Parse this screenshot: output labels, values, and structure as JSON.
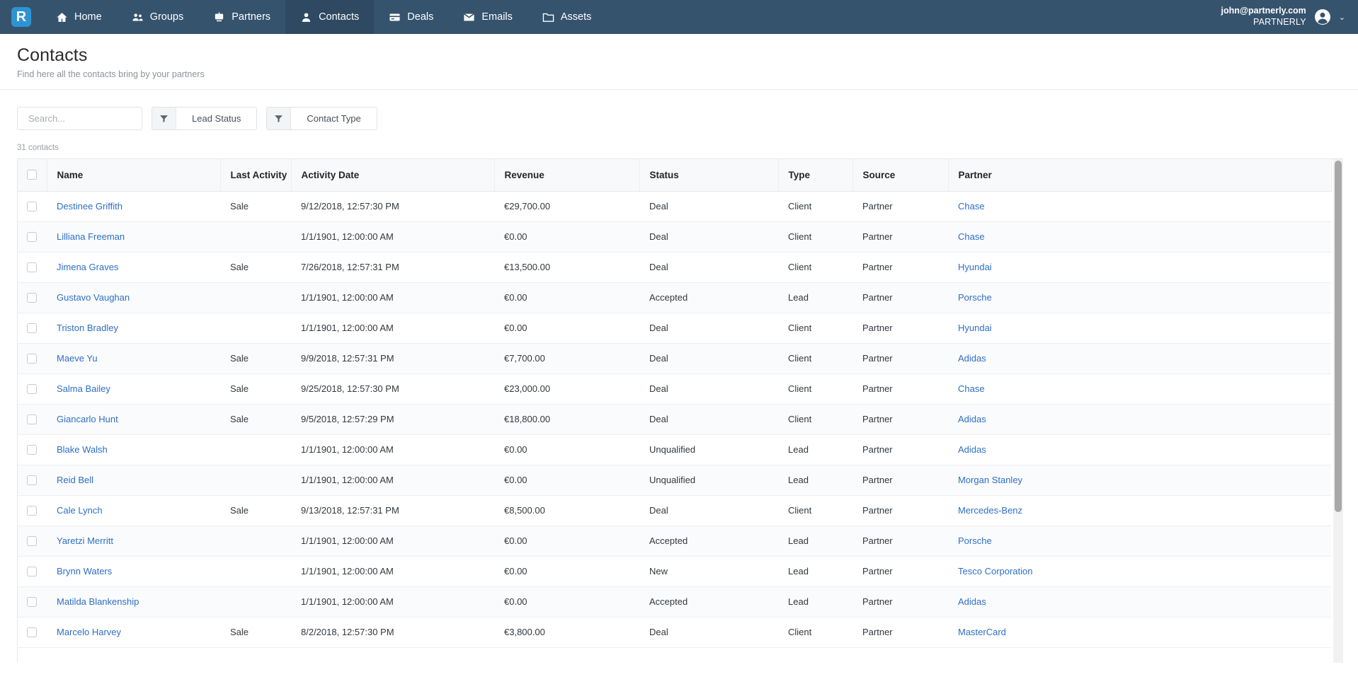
{
  "navbar": {
    "logo_letter": "R",
    "items": [
      {
        "label": "Home",
        "icon": "home-icon",
        "active": false
      },
      {
        "label": "Groups",
        "icon": "groups-icon",
        "active": false
      },
      {
        "label": "Partners",
        "icon": "partners-icon",
        "active": false
      },
      {
        "label": "Contacts",
        "icon": "contacts-icon",
        "active": true
      },
      {
        "label": "Deals",
        "icon": "deals-icon",
        "active": false
      },
      {
        "label": "Emails",
        "icon": "emails-icon",
        "active": false
      },
      {
        "label": "Assets",
        "icon": "assets-icon",
        "active": false
      }
    ],
    "user_email": "john@partnerly.com",
    "user_org": "PARTNERLY",
    "caret": "⌄"
  },
  "page": {
    "title": "Contacts",
    "subtitle": "Find here all the contacts bring by your partners"
  },
  "filters": {
    "search_placeholder": "Search...",
    "search_value": "",
    "lead_status_label": "Lead Status",
    "contact_type_label": "Contact Type"
  },
  "table": {
    "count_label": "31 contacts",
    "columns": [
      "Name",
      "Last Activity",
      "Activity Date",
      "Revenue",
      "Status",
      "Type",
      "Source",
      "Partner"
    ],
    "rows": [
      {
        "name": "Destinee Griffith",
        "last_activity": "Sale",
        "activity_date": "9/12/2018, 12:57:30 PM",
        "revenue": "€29,700.00",
        "status": "Deal",
        "type": "Client",
        "source": "Partner",
        "partner": "Chase"
      },
      {
        "name": "Lilliana Freeman",
        "last_activity": "",
        "activity_date": "1/1/1901, 12:00:00 AM",
        "revenue": "€0.00",
        "status": "Deal",
        "type": "Client",
        "source": "Partner",
        "partner": "Chase"
      },
      {
        "name": "Jimena Graves",
        "last_activity": "Sale",
        "activity_date": "7/26/2018, 12:57:31 PM",
        "revenue": "€13,500.00",
        "status": "Deal",
        "type": "Client",
        "source": "Partner",
        "partner": "Hyundai"
      },
      {
        "name": "Gustavo Vaughan",
        "last_activity": "",
        "activity_date": "1/1/1901, 12:00:00 AM",
        "revenue": "€0.00",
        "status": "Accepted",
        "type": "Lead",
        "source": "Partner",
        "partner": "Porsche"
      },
      {
        "name": "Triston Bradley",
        "last_activity": "",
        "activity_date": "1/1/1901, 12:00:00 AM",
        "revenue": "€0.00",
        "status": "Deal",
        "type": "Client",
        "source": "Partner",
        "partner": "Hyundai"
      },
      {
        "name": "Maeve Yu",
        "last_activity": "Sale",
        "activity_date": "9/9/2018, 12:57:31 PM",
        "revenue": "€7,700.00",
        "status": "Deal",
        "type": "Client",
        "source": "Partner",
        "partner": "Adidas"
      },
      {
        "name": "Salma Bailey",
        "last_activity": "Sale",
        "activity_date": "9/25/2018, 12:57:30 PM",
        "revenue": "€23,000.00",
        "status": "Deal",
        "type": "Client",
        "source": "Partner",
        "partner": "Chase"
      },
      {
        "name": "Giancarlo Hunt",
        "last_activity": "Sale",
        "activity_date": "9/5/2018, 12:57:29 PM",
        "revenue": "€18,800.00",
        "status": "Deal",
        "type": "Client",
        "source": "Partner",
        "partner": "Adidas"
      },
      {
        "name": "Blake Walsh",
        "last_activity": "",
        "activity_date": "1/1/1901, 12:00:00 AM",
        "revenue": "€0.00",
        "status": "Unqualified",
        "type": "Lead",
        "source": "Partner",
        "partner": "Adidas"
      },
      {
        "name": "Reid Bell",
        "last_activity": "",
        "activity_date": "1/1/1901, 12:00:00 AM",
        "revenue": "€0.00",
        "status": "Unqualified",
        "type": "Lead",
        "source": "Partner",
        "partner": "Morgan Stanley"
      },
      {
        "name": "Cale Lynch",
        "last_activity": "Sale",
        "activity_date": "9/13/2018, 12:57:31 PM",
        "revenue": "€8,500.00",
        "status": "Deal",
        "type": "Client",
        "source": "Partner",
        "partner": "Mercedes-Benz"
      },
      {
        "name": "Yaretzi Merritt",
        "last_activity": "",
        "activity_date": "1/1/1901, 12:00:00 AM",
        "revenue": "€0.00",
        "status": "Accepted",
        "type": "Lead",
        "source": "Partner",
        "partner": "Porsche"
      },
      {
        "name": "Brynn Waters",
        "last_activity": "",
        "activity_date": "1/1/1901, 12:00:00 AM",
        "revenue": "€0.00",
        "status": "New",
        "type": "Lead",
        "source": "Partner",
        "partner": "Tesco Corporation"
      },
      {
        "name": "Matilda Blankenship",
        "last_activity": "",
        "activity_date": "1/1/1901, 12:00:00 AM",
        "revenue": "€0.00",
        "status": "Accepted",
        "type": "Lead",
        "source": "Partner",
        "partner": "Adidas"
      },
      {
        "name": "Marcelo Harvey",
        "last_activity": "Sale",
        "activity_date": "8/2/2018, 12:57:30 PM",
        "revenue": "€3,800.00",
        "status": "Deal",
        "type": "Client",
        "source": "Partner",
        "partner": "MasterCard"
      }
    ]
  },
  "colors": {
    "navbar_bg": "#36536e",
    "navbar_active_bg": "#2e4961",
    "logo_bg": "#2d94d2",
    "link": "#2f6fc4"
  }
}
